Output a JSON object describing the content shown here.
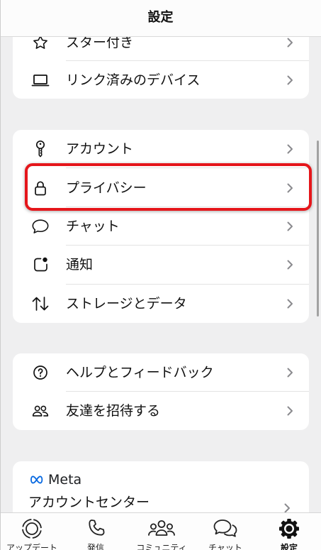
{
  "header": {
    "title": "設定"
  },
  "groups": [
    {
      "items": [
        {
          "label": "スター付き",
          "icon": "star-icon"
        },
        {
          "label": "リンク済みのデバイス",
          "icon": "laptop-icon"
        }
      ]
    },
    {
      "items": [
        {
          "label": "アカウント",
          "icon": "key-icon"
        },
        {
          "label": "プライバシー",
          "icon": "lock-icon",
          "highlighted": true
        },
        {
          "label": "チャット",
          "icon": "chat-bubble-icon"
        },
        {
          "label": "通知",
          "icon": "notification-icon"
        },
        {
          "label": "ストレージとデータ",
          "icon": "storage-arrows-icon"
        }
      ]
    },
    {
      "items": [
        {
          "label": "ヘルプとフィードバック",
          "icon": "help-icon"
        },
        {
          "label": "友達を招待する",
          "icon": "invite-friends-icon"
        }
      ]
    }
  ],
  "meta_section": {
    "brand": "Meta",
    "icon": "meta-infinity-icon",
    "title": "アカウントセンター"
  },
  "bottom_nav": {
    "items": [
      {
        "label": "アップデート",
        "icon": "status-icon",
        "active": false
      },
      {
        "label": "発信",
        "icon": "phone-icon",
        "active": false
      },
      {
        "label": "コミュニティ",
        "icon": "community-icon",
        "active": false
      },
      {
        "label": "チャット",
        "icon": "chats-icon",
        "active": false
      },
      {
        "label": "設定",
        "icon": "settings-gear-icon",
        "active": true
      }
    ]
  },
  "colors": {
    "background": "#efeff0",
    "card": "#ffffff",
    "text": "#111111",
    "chevron": "#8a8a8e",
    "highlight": "#e5161b",
    "meta_blue": "#0668e1"
  }
}
